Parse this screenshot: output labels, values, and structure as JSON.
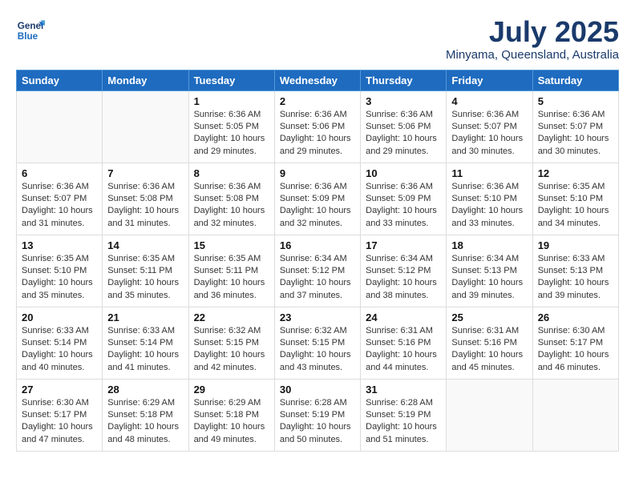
{
  "header": {
    "logo_line1": "General",
    "logo_line2": "Blue",
    "month": "July 2025",
    "location": "Minyama, Queensland, Australia"
  },
  "weekdays": [
    "Sunday",
    "Monday",
    "Tuesday",
    "Wednesday",
    "Thursday",
    "Friday",
    "Saturday"
  ],
  "weeks": [
    [
      {
        "day": "",
        "info": ""
      },
      {
        "day": "",
        "info": ""
      },
      {
        "day": "1",
        "info": "Sunrise: 6:36 AM\nSunset: 5:05 PM\nDaylight: 10 hours\nand 29 minutes."
      },
      {
        "day": "2",
        "info": "Sunrise: 6:36 AM\nSunset: 5:06 PM\nDaylight: 10 hours\nand 29 minutes."
      },
      {
        "day": "3",
        "info": "Sunrise: 6:36 AM\nSunset: 5:06 PM\nDaylight: 10 hours\nand 29 minutes."
      },
      {
        "day": "4",
        "info": "Sunrise: 6:36 AM\nSunset: 5:07 PM\nDaylight: 10 hours\nand 30 minutes."
      },
      {
        "day": "5",
        "info": "Sunrise: 6:36 AM\nSunset: 5:07 PM\nDaylight: 10 hours\nand 30 minutes."
      }
    ],
    [
      {
        "day": "6",
        "info": "Sunrise: 6:36 AM\nSunset: 5:07 PM\nDaylight: 10 hours\nand 31 minutes."
      },
      {
        "day": "7",
        "info": "Sunrise: 6:36 AM\nSunset: 5:08 PM\nDaylight: 10 hours\nand 31 minutes."
      },
      {
        "day": "8",
        "info": "Sunrise: 6:36 AM\nSunset: 5:08 PM\nDaylight: 10 hours\nand 32 minutes."
      },
      {
        "day": "9",
        "info": "Sunrise: 6:36 AM\nSunset: 5:09 PM\nDaylight: 10 hours\nand 32 minutes."
      },
      {
        "day": "10",
        "info": "Sunrise: 6:36 AM\nSunset: 5:09 PM\nDaylight: 10 hours\nand 33 minutes."
      },
      {
        "day": "11",
        "info": "Sunrise: 6:36 AM\nSunset: 5:10 PM\nDaylight: 10 hours\nand 33 minutes."
      },
      {
        "day": "12",
        "info": "Sunrise: 6:35 AM\nSunset: 5:10 PM\nDaylight: 10 hours\nand 34 minutes."
      }
    ],
    [
      {
        "day": "13",
        "info": "Sunrise: 6:35 AM\nSunset: 5:10 PM\nDaylight: 10 hours\nand 35 minutes."
      },
      {
        "day": "14",
        "info": "Sunrise: 6:35 AM\nSunset: 5:11 PM\nDaylight: 10 hours\nand 35 minutes."
      },
      {
        "day": "15",
        "info": "Sunrise: 6:35 AM\nSunset: 5:11 PM\nDaylight: 10 hours\nand 36 minutes."
      },
      {
        "day": "16",
        "info": "Sunrise: 6:34 AM\nSunset: 5:12 PM\nDaylight: 10 hours\nand 37 minutes."
      },
      {
        "day": "17",
        "info": "Sunrise: 6:34 AM\nSunset: 5:12 PM\nDaylight: 10 hours\nand 38 minutes."
      },
      {
        "day": "18",
        "info": "Sunrise: 6:34 AM\nSunset: 5:13 PM\nDaylight: 10 hours\nand 39 minutes."
      },
      {
        "day": "19",
        "info": "Sunrise: 6:33 AM\nSunset: 5:13 PM\nDaylight: 10 hours\nand 39 minutes."
      }
    ],
    [
      {
        "day": "20",
        "info": "Sunrise: 6:33 AM\nSunset: 5:14 PM\nDaylight: 10 hours\nand 40 minutes."
      },
      {
        "day": "21",
        "info": "Sunrise: 6:33 AM\nSunset: 5:14 PM\nDaylight: 10 hours\nand 41 minutes."
      },
      {
        "day": "22",
        "info": "Sunrise: 6:32 AM\nSunset: 5:15 PM\nDaylight: 10 hours\nand 42 minutes."
      },
      {
        "day": "23",
        "info": "Sunrise: 6:32 AM\nSunset: 5:15 PM\nDaylight: 10 hours\nand 43 minutes."
      },
      {
        "day": "24",
        "info": "Sunrise: 6:31 AM\nSunset: 5:16 PM\nDaylight: 10 hours\nand 44 minutes."
      },
      {
        "day": "25",
        "info": "Sunrise: 6:31 AM\nSunset: 5:16 PM\nDaylight: 10 hours\nand 45 minutes."
      },
      {
        "day": "26",
        "info": "Sunrise: 6:30 AM\nSunset: 5:17 PM\nDaylight: 10 hours\nand 46 minutes."
      }
    ],
    [
      {
        "day": "27",
        "info": "Sunrise: 6:30 AM\nSunset: 5:17 PM\nDaylight: 10 hours\nand 47 minutes."
      },
      {
        "day": "28",
        "info": "Sunrise: 6:29 AM\nSunset: 5:18 PM\nDaylight: 10 hours\nand 48 minutes."
      },
      {
        "day": "29",
        "info": "Sunrise: 6:29 AM\nSunset: 5:18 PM\nDaylight: 10 hours\nand 49 minutes."
      },
      {
        "day": "30",
        "info": "Sunrise: 6:28 AM\nSunset: 5:19 PM\nDaylight: 10 hours\nand 50 minutes."
      },
      {
        "day": "31",
        "info": "Sunrise: 6:28 AM\nSunset: 5:19 PM\nDaylight: 10 hours\nand 51 minutes."
      },
      {
        "day": "",
        "info": ""
      },
      {
        "day": "",
        "info": ""
      }
    ]
  ]
}
